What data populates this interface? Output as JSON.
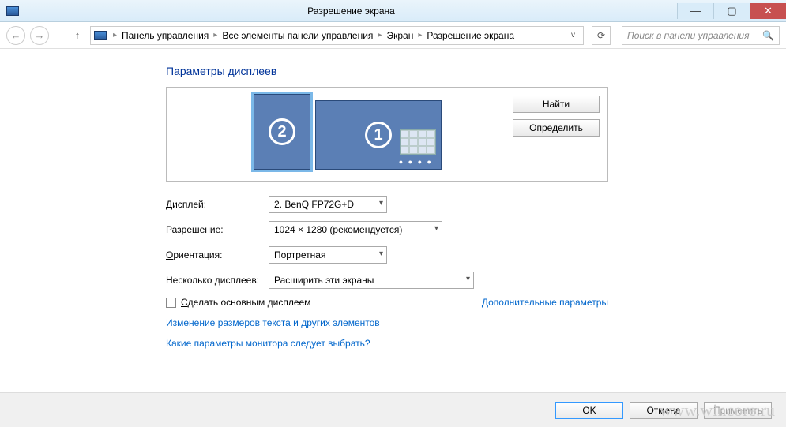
{
  "window": {
    "title": "Разрешение экрана"
  },
  "nav": {
    "crumbs": [
      "Панель управления",
      "Все элементы панели управления",
      "Экран",
      "Разрешение экрана"
    ],
    "search_placeholder": "Поиск в панели управления"
  },
  "page": {
    "heading": "Параметры дисплеев",
    "buttons": {
      "find": "Найти",
      "detect": "Определить"
    },
    "monitors": {
      "m1": "1",
      "m2": "2"
    },
    "labels": {
      "display": "Дисплей:",
      "resolution": "Разрешение:",
      "orientation": "Ориентация:",
      "multi": "Несколько дисплеев:"
    },
    "values": {
      "display": "2. BenQ FP72G+D",
      "resolution": "1024 × 1280 (рекомендуется)",
      "orientation": "Портретная",
      "multi": "Расширить эти экраны"
    },
    "checkbox": "Сделать основным дисплеем",
    "adv_link": "Дополнительные параметры",
    "link_textsize": "Изменение размеров текста и других элементов",
    "link_help": "Какие параметры монитора следует выбрать?"
  },
  "footer": {
    "ok": "OK",
    "cancel": "Отмена",
    "apply": "Применить"
  },
  "watermark": "www.wincore.ru"
}
